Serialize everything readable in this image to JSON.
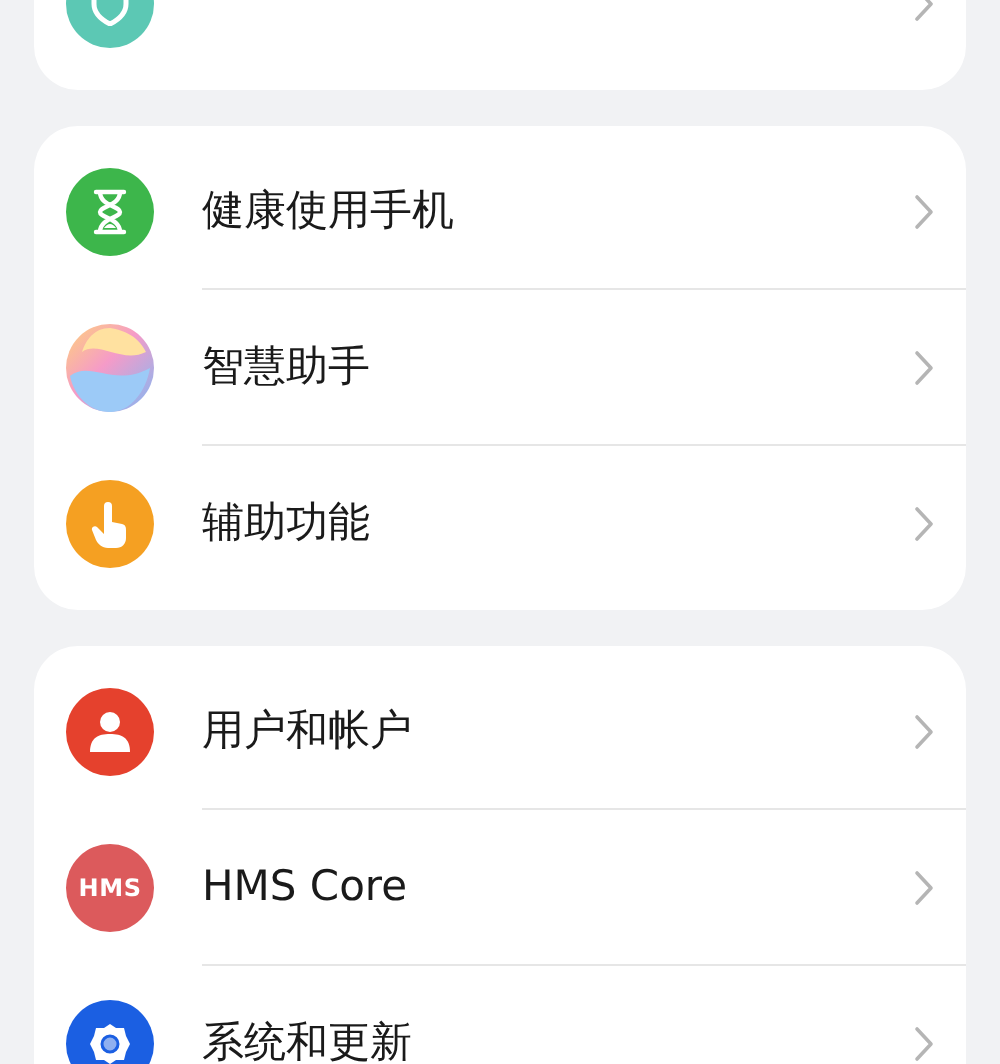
{
  "groups": [
    {
      "items": [
        {
          "kind": "shield",
          "color": "#5cc8b4"
        }
      ]
    },
    {
      "items": [
        {
          "kind": "hourglass",
          "color": "#3db64b",
          "label": "健康使用手机"
        },
        {
          "kind": "orb",
          "label": "智慧助手"
        },
        {
          "kind": "hand",
          "color": "#f5a022",
          "label": "辅助功能"
        }
      ]
    },
    {
      "items": [
        {
          "kind": "person",
          "color": "#e5412d",
          "label": "用户和帐户"
        },
        {
          "kind": "badge",
          "color": "#dc5a5c",
          "badge_text": "HMS",
          "label": "HMS Core"
        },
        {
          "kind": "gear",
          "color": "#1b5fe2",
          "label": "系统和更新"
        }
      ]
    }
  ]
}
